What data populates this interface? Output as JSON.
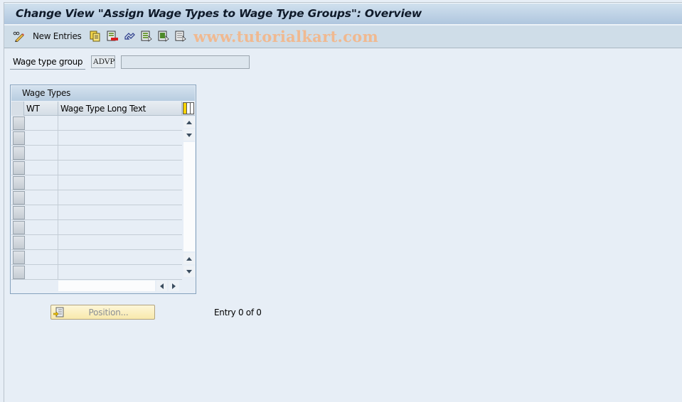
{
  "window": {
    "title": "Change View \"Assign Wage Types to Wage Type Groups\": Overview"
  },
  "toolbar": {
    "items": [
      {
        "icon": "pencil-glasses-icon",
        "label": ""
      },
      {
        "icon": "none",
        "label": "New Entries"
      },
      {
        "icon": "copy-as-icon",
        "label": ""
      },
      {
        "icon": "delete-icon",
        "label": ""
      },
      {
        "icon": "undo-change-icon",
        "label": ""
      },
      {
        "icon": "select-all-icon",
        "label": ""
      },
      {
        "icon": "select-block-icon",
        "label": ""
      },
      {
        "icon": "deselect-all-icon",
        "label": ""
      }
    ],
    "new_entries_label": "New Entries",
    "watermark": "www.tutorialkart.com"
  },
  "header_fields": {
    "wage_type_group_label": "Wage type group",
    "wage_type_group_value": "ADVP",
    "wage_type_group_description": ""
  },
  "table": {
    "title": "Wage Types",
    "columns": [
      "WT",
      "Wage Type Long Text"
    ],
    "rows": [
      {
        "wt": "",
        "text": ""
      },
      {
        "wt": "",
        "text": ""
      },
      {
        "wt": "",
        "text": ""
      },
      {
        "wt": "",
        "text": ""
      },
      {
        "wt": "",
        "text": ""
      },
      {
        "wt": "",
        "text": ""
      },
      {
        "wt": "",
        "text": ""
      },
      {
        "wt": "",
        "text": ""
      },
      {
        "wt": "",
        "text": ""
      },
      {
        "wt": "",
        "text": ""
      },
      {
        "wt": "",
        "text": ""
      }
    ],
    "column_settings_icon": "table-settings-icon"
  },
  "footer": {
    "position_button_label": "Position...",
    "entry_info": "Entry 0 of 0"
  },
  "colors": {
    "background": "#e7eef6",
    "title_bar": "#b9cfe3",
    "toolbar": "#cfdde8",
    "position_button": "#f8e9ac",
    "watermark": "#f0b990"
  }
}
